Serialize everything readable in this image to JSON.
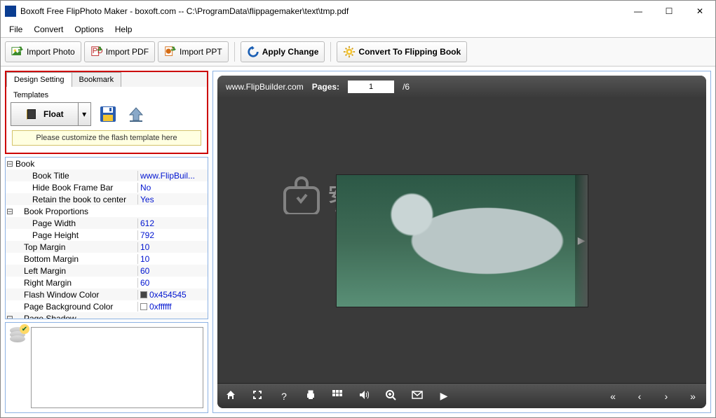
{
  "window": {
    "title": "Boxoft Free FlipPhoto Maker - boxoft.com -- C:\\ProgramData\\flippagemaker\\text\\tmp.pdf"
  },
  "menu": {
    "file": "File",
    "convert": "Convert",
    "options": "Options",
    "help": "Help"
  },
  "toolbar": {
    "import_photo": "Import Photo",
    "import_pdf": "Import PDF",
    "import_ppt": "Import PPT",
    "apply_change": "Apply Change",
    "convert_book": "Convert To Flipping Book"
  },
  "tabs": {
    "design": "Design Setting",
    "bookmark": "Bookmark"
  },
  "template": {
    "section_label": "Templates",
    "name": "Float",
    "hint": "Please customize the flash template here"
  },
  "props": [
    {
      "k": "Book",
      "v": "",
      "cat": true,
      "exp": "⊟"
    },
    {
      "k": "Book Title",
      "v": "www.FlipBuil...",
      "indent": 2
    },
    {
      "k": "Hide Book Frame Bar",
      "v": "No",
      "indent": 2
    },
    {
      "k": "Retain the book to center",
      "v": "Yes",
      "indent": 2
    },
    {
      "k": "Book Proportions",
      "v": "",
      "cat": true,
      "indent": 1,
      "exp": "⊟"
    },
    {
      "k": "Page Width",
      "v": "612",
      "indent": 2
    },
    {
      "k": "Page Height",
      "v": "792",
      "indent": 2
    },
    {
      "k": "Top Margin",
      "v": "10",
      "indent": 1
    },
    {
      "k": "Bottom Margin",
      "v": "10",
      "indent": 1
    },
    {
      "k": "Left Margin",
      "v": "60",
      "indent": 1
    },
    {
      "k": "Right Margin",
      "v": "60",
      "indent": 1
    },
    {
      "k": "Flash Window Color",
      "v": "0x454545",
      "indent": 1,
      "swatch": "#454545"
    },
    {
      "k": "Page Background Color",
      "v": "0xffffff",
      "indent": 1,
      "swatch": "#ffffff"
    },
    {
      "k": "Page Shadow",
      "v": "",
      "cat": true,
      "indent": 1,
      "exp": "⊟"
    }
  ],
  "preview": {
    "url": "www.FlipBuilder.com",
    "pages_label": "Pages:",
    "page_current": "1",
    "page_total": "/6",
    "watermark_main": "安下载",
    "watermark_sub": "anxz.com"
  }
}
